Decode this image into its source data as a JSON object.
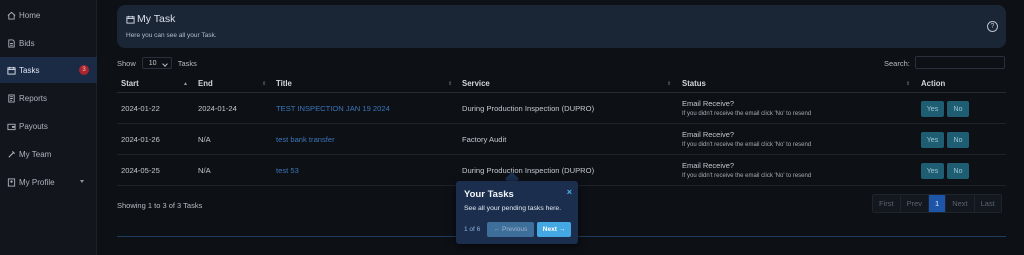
{
  "sidebar": {
    "items": [
      {
        "label": "Home",
        "icon": "home-icon"
      },
      {
        "label": "Bids",
        "icon": "document-icon"
      },
      {
        "label": "Tasks",
        "icon": "calendar-icon",
        "badge": "3"
      },
      {
        "label": "Reports",
        "icon": "report-icon"
      },
      {
        "label": "Payouts",
        "icon": "wallet-icon"
      },
      {
        "label": "My Team",
        "icon": "team-icon"
      },
      {
        "label": "My Profile",
        "icon": "profile-icon"
      }
    ]
  },
  "header": {
    "title": "My Task",
    "subtitle": "Here you can see all your Task.",
    "help": "?"
  },
  "controls": {
    "show_label": "Show",
    "page_size": "10",
    "tasks_label": "Tasks",
    "search_label": "Search:"
  },
  "table": {
    "columns": [
      "Start",
      "End",
      "Title",
      "Service",
      "Status",
      "Action"
    ],
    "rows": [
      {
        "start": "2024-01-22",
        "end": "2024-01-24",
        "title": "TEST INSPECTION JAN 19 2024",
        "service": "During Production Inspection (DUPRO)",
        "status": "Email Receive?",
        "status_note": "If you didn't receive the email click 'No' to resend",
        "yes": "Yes",
        "no": "No"
      },
      {
        "start": "2024-01-26",
        "end": "N/A",
        "title": "test bank transfer",
        "service": "Factory Audit",
        "status": "Email Receive?",
        "status_note": "If you didn't receive the email click 'No' to resend",
        "yes": "Yes",
        "no": "No"
      },
      {
        "start": "2024-05-25",
        "end": "N/A",
        "title": "test 53",
        "service": "During Production Inspection (DUPRO)",
        "status": "Email Receive?",
        "status_note": "If you didn't receive the email click 'No' to resend",
        "yes": "Yes",
        "no": "No"
      }
    ]
  },
  "footer": {
    "info": "Showing 1 to 3 of 3 Tasks",
    "pagination": [
      "First",
      "Prev",
      "1",
      "Next",
      "Last"
    ]
  },
  "tour": {
    "title": "Your Tasks",
    "close": "×",
    "description": "See all your pending tasks here.",
    "progress": "1 of 6",
    "prev_label": "← Previous",
    "next_label": "Next →"
  },
  "colors": {
    "accent": "#1d56a8",
    "tour_next": "#43a8e3",
    "action_button": "#1f5d73",
    "badge": "#a8242e"
  }
}
